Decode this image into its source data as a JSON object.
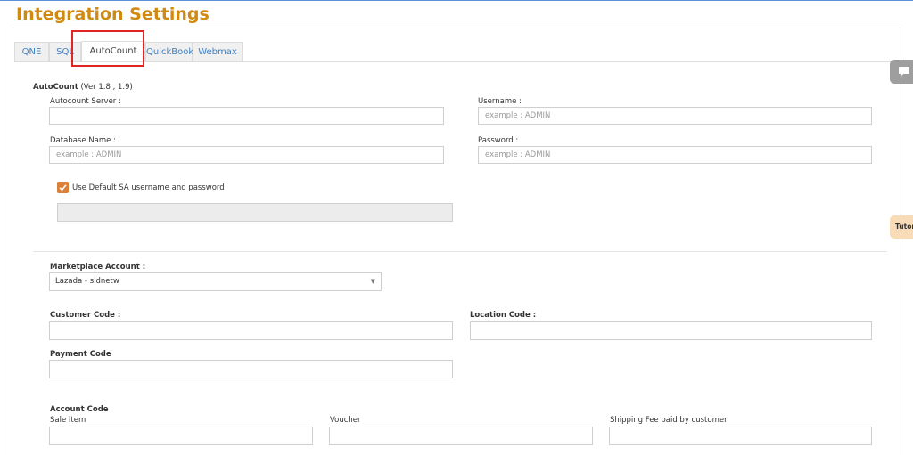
{
  "page": {
    "title": "Integration Settings"
  },
  "tabs": [
    {
      "label": "QNE"
    },
    {
      "label": "SQL"
    },
    {
      "label": "AutoCount",
      "active": true
    },
    {
      "label": "QuickBook"
    },
    {
      "label": "Webmax"
    }
  ],
  "autocount": {
    "heading": "AutoCount",
    "version": "(Ver 1.8 , 1.9)",
    "server_label": "Autocount Server :",
    "server_value": "",
    "username_label": "Username :",
    "username_placeholder": "example : ADMIN",
    "dbname_label": "Database Name :",
    "dbname_placeholder": "example : ADMIN",
    "password_label": "Password :",
    "password_placeholder": "example : ADMIN",
    "default_sa_label": "Use Default SA username and password",
    "default_sa_checked": true
  },
  "marketplace": {
    "label": "Marketplace Account :",
    "selected": "Lazada - sldnetw"
  },
  "codes": {
    "customer_label": "Customer Code :",
    "location_label": "Location Code :",
    "payment_label": "Payment Code"
  },
  "account_code": {
    "heading": "Account Code",
    "sale_item_label": "Sale Item",
    "voucher_label": "Voucher",
    "shipping_label": "Shipping Fee paid by customer"
  },
  "side_widgets": {
    "tutorial_label": "Tutor"
  },
  "colors": {
    "title": "#d08a12",
    "checkbox": "#d9803b",
    "tab_link": "#3f7fbf",
    "highlight": "#e12424"
  }
}
